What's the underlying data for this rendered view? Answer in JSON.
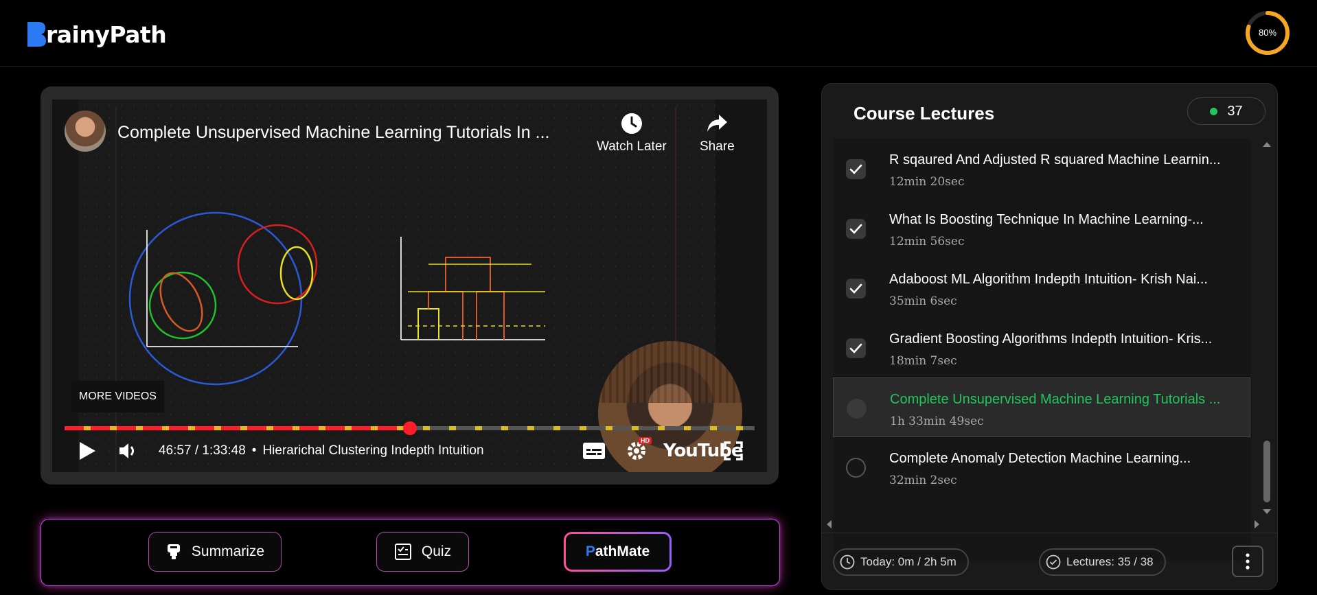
{
  "app": {
    "brand": "rainyPath",
    "brand_initial": "B",
    "progress_percent": 80,
    "progress_label": "80%",
    "accent_color": "#f5a623"
  },
  "video": {
    "title": "Complete Unsupervised Machine Learning Tutorials In ...",
    "watch_later_label": "Watch Later",
    "share_label": "Share",
    "more_videos_label": "MORE VIDEOS",
    "current_time": "46:57",
    "duration": "1:33:48",
    "time_display": "46:57 / 1:33:48",
    "separator": "•",
    "chapter": "Hierarichal Clustering Indepth Intuition",
    "played_fraction": 0.5,
    "hd_badge": "HD",
    "platform": "YouTube",
    "timeline_color": "#ff1d2a"
  },
  "actions": {
    "summarize_label": "Summarize",
    "quiz_label": "Quiz",
    "pathmate_initial": "P",
    "pathmate_label": "athMate"
  },
  "lectures": {
    "title": "Course Lectures",
    "count": "37",
    "items": [
      {
        "title": "R sqaured And Adjusted R squared Machine Learnin...",
        "duration": "12min 20sec",
        "completed": true,
        "active": false
      },
      {
        "title": "What Is Boosting Technique In Machine Learning-...",
        "duration": "12min 56sec",
        "completed": true,
        "active": false
      },
      {
        "title": "Adaboost ML Algorithm Indepth Intuition- Krish Nai...",
        "duration": "35min 6sec",
        "completed": true,
        "active": false
      },
      {
        "title": "Gradient Boosting Algorithms Indepth Intuition- Kris...",
        "duration": "18min 7sec",
        "completed": true,
        "active": false
      },
      {
        "title": "Complete Unsupervised Machine Learning Tutorials ...",
        "duration": "1h 33min 49sec",
        "completed": false,
        "active": true
      },
      {
        "title": "Complete Anomaly Detection Machine Learning...",
        "duration": "32min 2sec",
        "completed": false,
        "active": false
      }
    ],
    "today_label": "Today: 0m / 2h 5m",
    "lectures_label": "Lectures: 35 / 38",
    "active_color": "#22c55e"
  }
}
